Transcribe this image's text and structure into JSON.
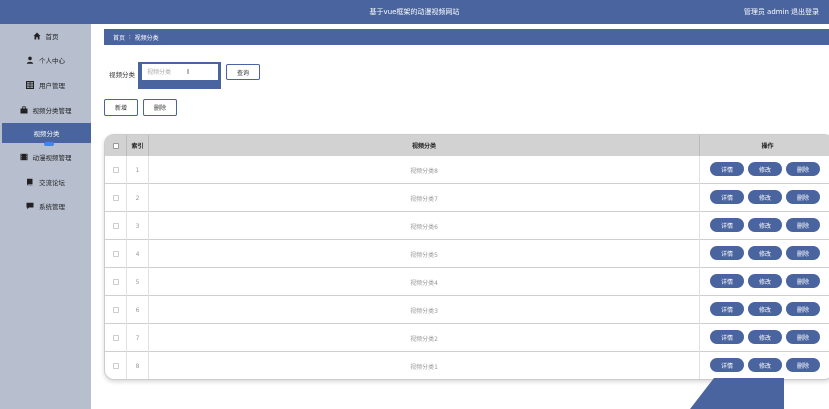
{
  "header": {
    "title": "基于vue框架的动漫视频网站",
    "user": "管理员 admin",
    "logout": "退出登录"
  },
  "sidebar": {
    "items": [
      {
        "label": "首页",
        "icon": "home-icon"
      },
      {
        "label": "个人中心",
        "icon": "user-icon"
      },
      {
        "label": "用户管理",
        "icon": "grid-icon"
      },
      {
        "label": "视频分类管理",
        "icon": "briefcase-icon"
      },
      {
        "label": "视频分类",
        "icon": ""
      },
      {
        "label": "动漫视频管理",
        "icon": "film-icon"
      },
      {
        "label": "交流论坛",
        "icon": "book-icon"
      },
      {
        "label": "系统管理",
        "icon": "chat-icon"
      }
    ]
  },
  "breadcrumb": {
    "home": "首页",
    "separator": "∶",
    "current": "视频分类"
  },
  "search": {
    "label": "视频分类",
    "placeholder": "视频分类",
    "button": "查询"
  },
  "actions": {
    "add": "新增",
    "delete": "删除"
  },
  "table": {
    "headers": {
      "index": "索引",
      "category": "视频分类",
      "ops": "操作"
    },
    "rows": [
      {
        "index": "1",
        "category": "视频分类8"
      },
      {
        "index": "2",
        "category": "视频分类7"
      },
      {
        "index": "3",
        "category": "视频分类6"
      },
      {
        "index": "4",
        "category": "视频分类5"
      },
      {
        "index": "5",
        "category": "视频分类4"
      },
      {
        "index": "6",
        "category": "视频分类3"
      },
      {
        "index": "7",
        "category": "视频分类2"
      },
      {
        "index": "8",
        "category": "视频分类1"
      }
    ],
    "row_buttons": {
      "detail": "详情",
      "edit": "修改",
      "delete": "删除"
    }
  },
  "colors": {
    "primary": "#4a64a0",
    "sidebar": "#b7bfcf",
    "header_row": "#d2d2d2"
  }
}
